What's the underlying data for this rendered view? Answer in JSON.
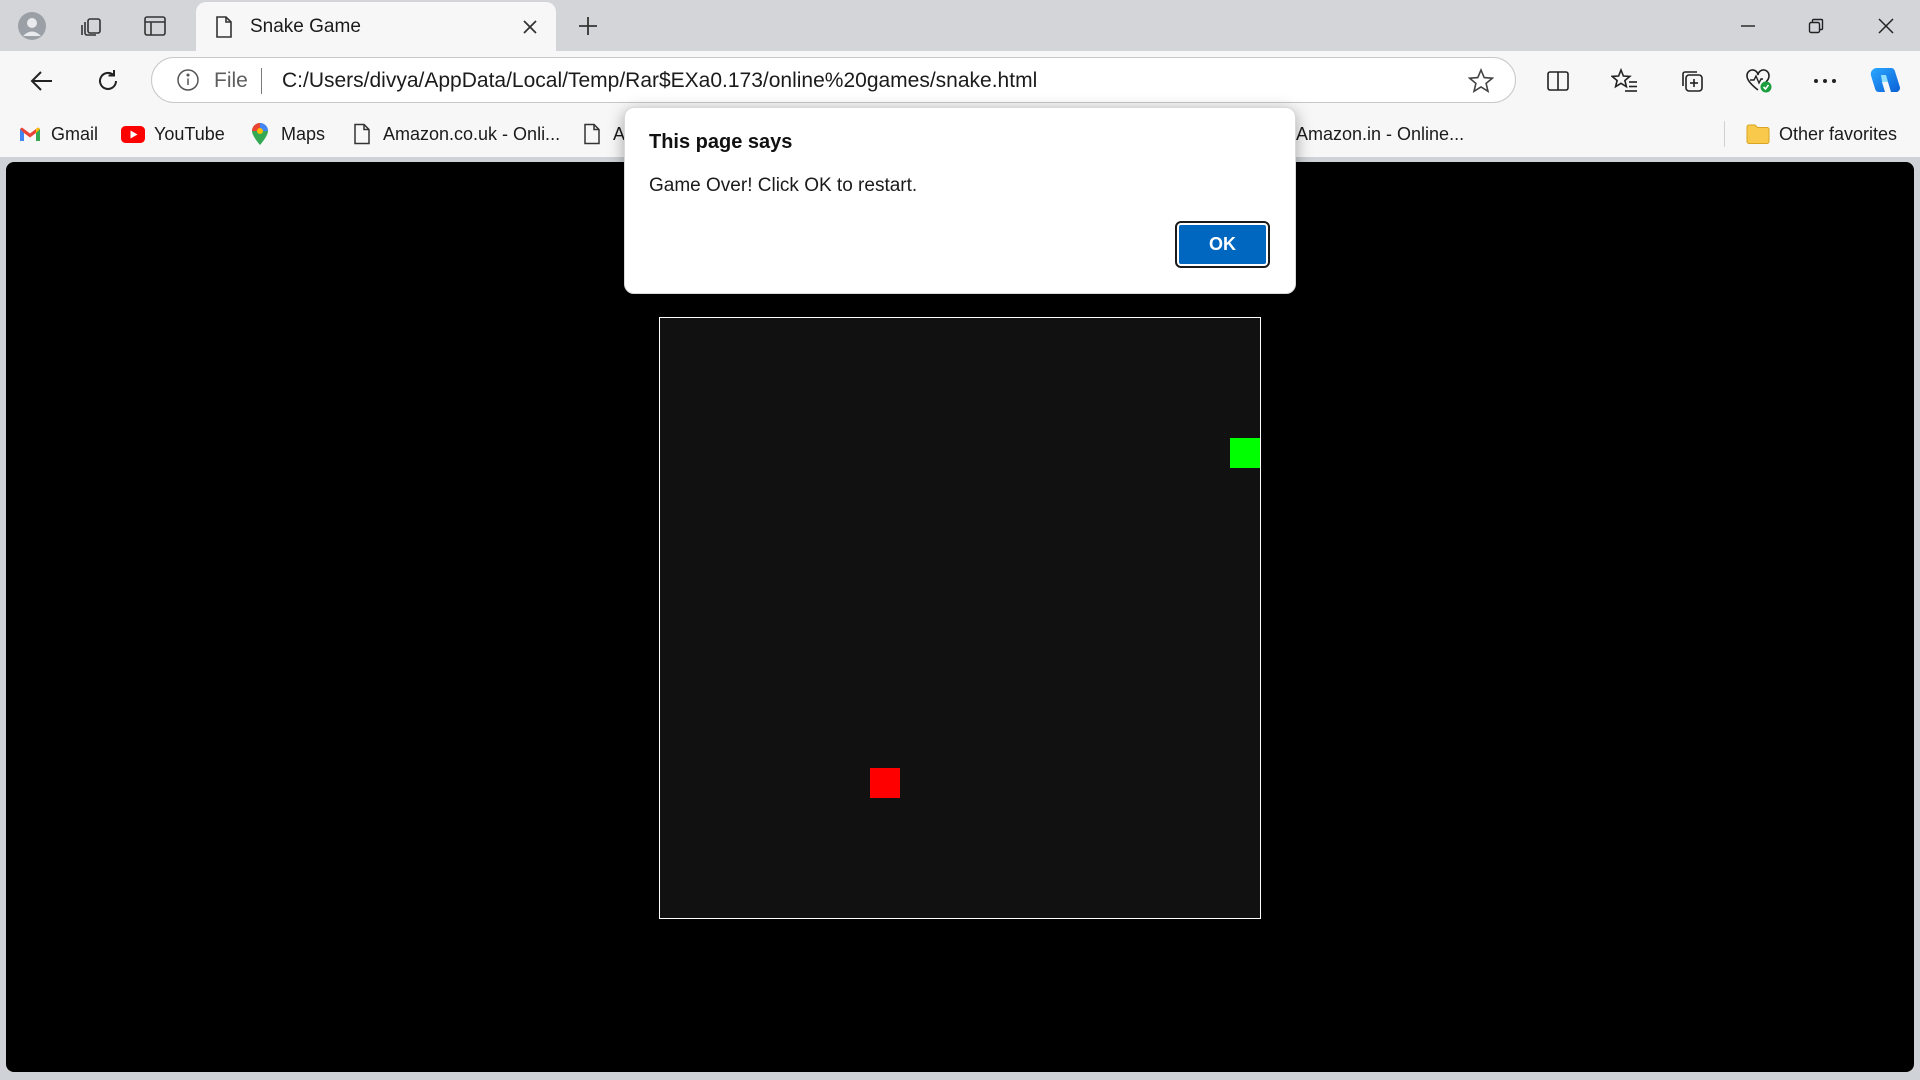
{
  "browser": {
    "tab": {
      "title": "Snake Game"
    },
    "address_bar": {
      "scheme_label": "File",
      "url": "C:/Users/divya/AppData/Local/Temp/Rar$EXa0.173/online%20games/snake.html"
    },
    "favorites": [
      {
        "label": "Gmail",
        "icon": "gmail-icon"
      },
      {
        "label": "YouTube",
        "icon": "youtube-icon"
      },
      {
        "label": "Maps",
        "icon": "maps-icon"
      },
      {
        "label": "Amazon.co.uk - Onli...",
        "icon": "page-icon"
      },
      {
        "label": "A",
        "icon": "page-icon"
      },
      {
        "label": "Amazon.in - Online...",
        "icon": "page-icon"
      }
    ],
    "other_favorites": "Other favorites"
  },
  "dialog": {
    "title": "This page says",
    "message": "Game Over! Click OK to restart.",
    "ok_label": "OK"
  },
  "game": {
    "grid_cells": 20,
    "snake": [
      {
        "col": 19,
        "row": 4
      }
    ],
    "food": {
      "col": 7,
      "row": 15
    },
    "colors": {
      "page_background": "#000000",
      "board_background": "#111111",
      "board_border": "#ffffff",
      "snake": "#00ff00",
      "food": "#ff0000"
    }
  },
  "colors": {
    "accent": "#0067c0"
  }
}
